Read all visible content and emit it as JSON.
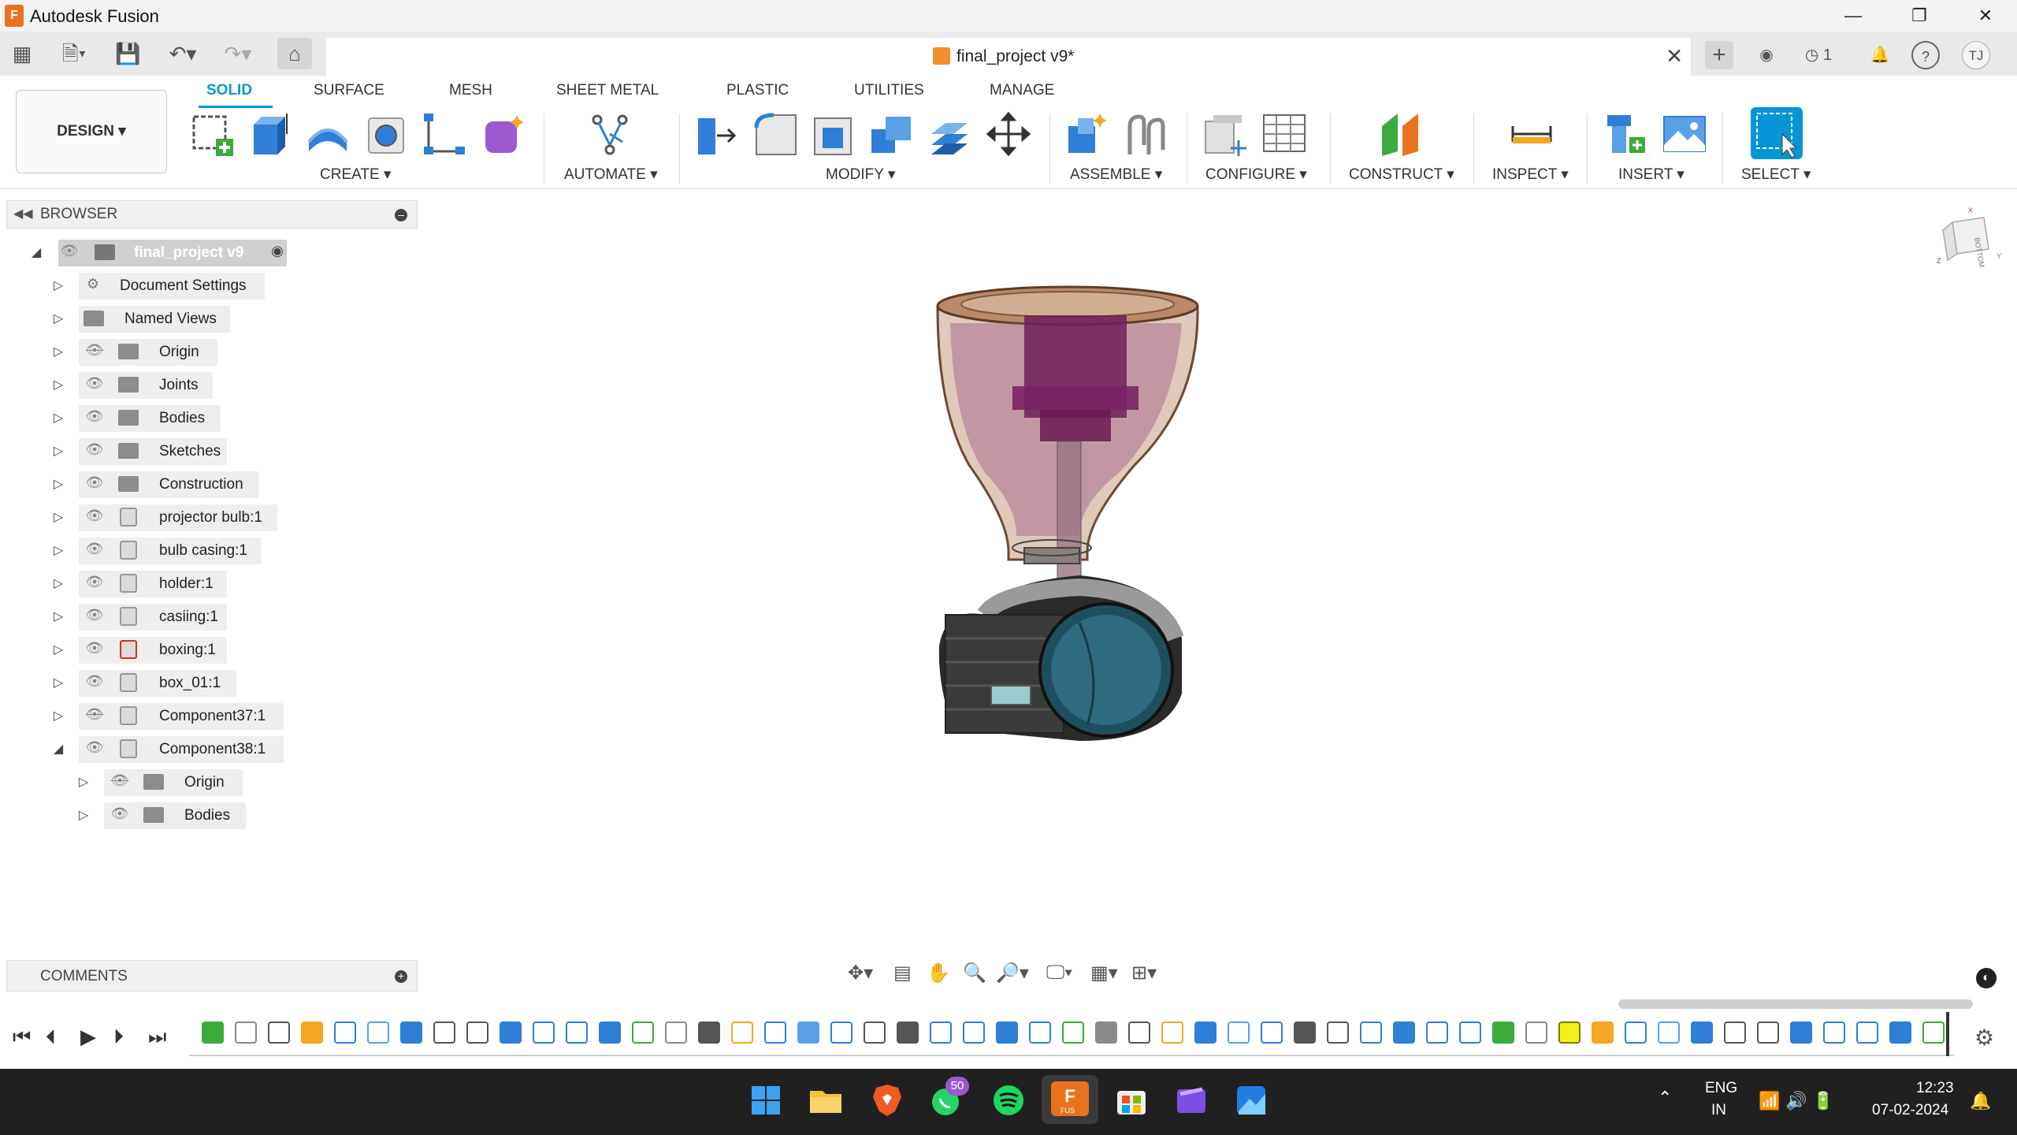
{
  "window": {
    "app_title": "Autodesk Fusion",
    "app_icon_letter": "F",
    "minimize": "—",
    "maximize": "❐",
    "close": "✕"
  },
  "quick_access": {
    "document_tab": "final_project v9*",
    "tab_close": "✕",
    "user_initials": "TJ",
    "job_count": "1"
  },
  "ribbon": {
    "workspace": "DESIGN ▾",
    "tabs": [
      "SOLID",
      "SURFACE",
      "MESH",
      "SHEET METAL",
      "PLASTIC",
      "UTILITIES",
      "MANAGE"
    ],
    "groups": [
      "CREATE ▾",
      "AUTOMATE ▾",
      "MODIFY ▾",
      "ASSEMBLE ▾",
      "CONFIGURE ▾",
      "CONSTRUCT ▾",
      "INSPECT ▾",
      "INSERT ▾",
      "SELECT ▾"
    ]
  },
  "browser": {
    "title": "BROWSER",
    "root": "final_project v9",
    "items": [
      "Document Settings",
      "Named Views",
      "Origin",
      "Joints",
      "Bodies",
      "Sketches",
      "Construction",
      "projector bulb:1",
      "bulb casing:1",
      "holder:1",
      "casiing:1",
      "boxing:1",
      "box_01:1",
      "Component37:1",
      "Component38:1",
      "Origin",
      "Bodies"
    ]
  },
  "comments": {
    "title": "COMMENTS"
  },
  "viewcube": {
    "face": "BOTTOM",
    "axis_x": "X",
    "axis_y": "Y",
    "axis_z": "Z"
  },
  "taskbar": {
    "whatsapp_badge": "50",
    "fusion_label": "FUS",
    "lang_top": "ENG",
    "lang_bottom": "IN",
    "time": "12:23",
    "date": "07-02-2024"
  },
  "colors": {
    "accent": "#0696d7",
    "fusion_orange": "#e8731c",
    "taskbar": "#202020"
  }
}
